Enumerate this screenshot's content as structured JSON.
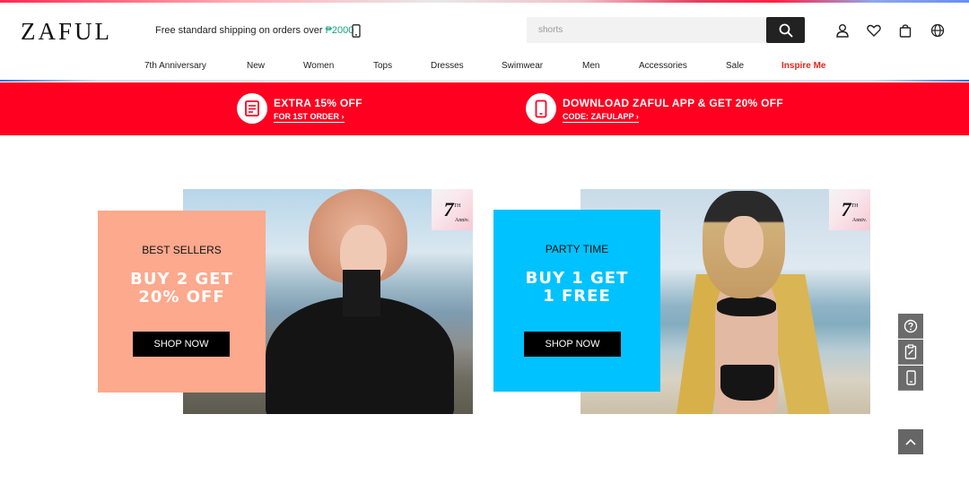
{
  "header": {
    "logo": "ZAFUL",
    "shipping_prefix": "Free standard shipping on orders over ",
    "shipping_amount": "₱2000",
    "search_placeholder": "shorts"
  },
  "nav": {
    "items": [
      "7th Anniversary",
      "New",
      "Women",
      "Tops",
      "Dresses",
      "Swimwear",
      "Men",
      "Accessories",
      "Sale",
      "Inspire Me"
    ]
  },
  "promo": {
    "left_title": "EXTRA 15% OFF",
    "left_sub": "FOR 1ST ORDER ›",
    "right_title": "DOWNLOAD ZAFUL APP & GET 20% OFF",
    "right_sub": "CODE: ZAFULAPP ›"
  },
  "banners": [
    {
      "kicker": "BEST SELLERS",
      "offer_line1": "BUY 2 GET",
      "offer_line2": "20% OFF",
      "button": "SHOP NOW",
      "badge_num": "7",
      "badge_sup": "TH",
      "badge_text": "Anniv."
    },
    {
      "kicker": "PARTY TIME",
      "offer_line1": "BUY 1 GET",
      "offer_line2": "1 FREE",
      "button": "SHOP NOW",
      "badge_num": "7",
      "badge_sup": "TH",
      "badge_text": "Anniv."
    }
  ],
  "colors": {
    "promo_bg": "#ff0020",
    "card1_bg": "#fca98e",
    "card2_bg": "#00c2ff",
    "inspire_red": "#e8261a",
    "price_green": "#12a37b"
  },
  "icons": [
    "phone-icon",
    "search-icon",
    "account-icon",
    "wishlist-icon",
    "bag-icon",
    "globe-icon",
    "coupon-icon",
    "mobile-app-icon",
    "help-icon",
    "survey-icon",
    "app-icon",
    "arrow-up-icon"
  ]
}
